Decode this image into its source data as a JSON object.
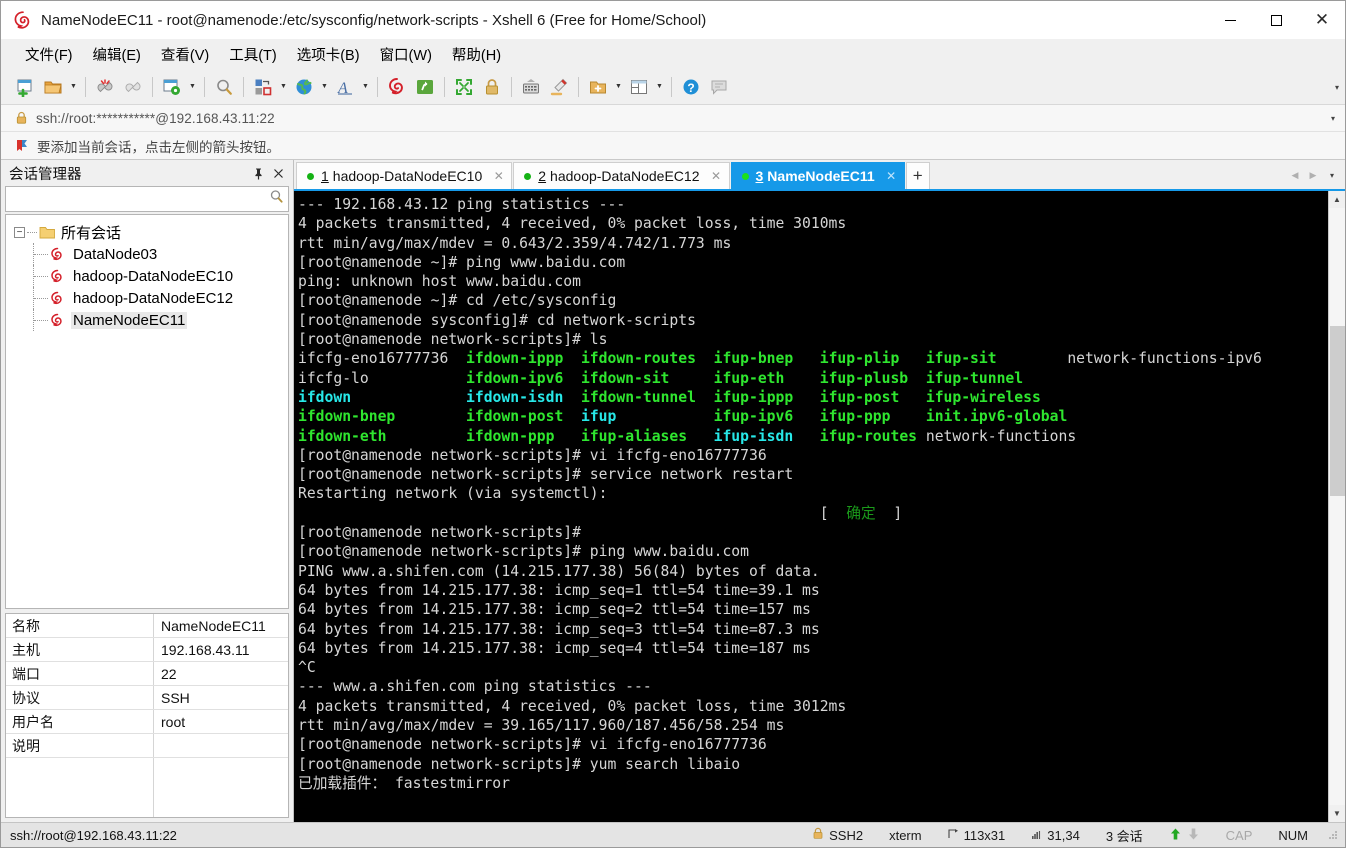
{
  "window": {
    "title": "NameNodeEC11 - root@namenode:/etc/sysconfig/network-scripts - Xshell 6 (Free for Home/School)",
    "app_icon": "xshell-logo-icon",
    "minimize_label": "",
    "maximize_label": "",
    "close_label": "✕"
  },
  "menubar": {
    "items": [
      {
        "label": "文件(F)",
        "name": "menu-file"
      },
      {
        "label": "编辑(E)",
        "name": "menu-edit"
      },
      {
        "label": "查看(V)",
        "name": "menu-view"
      },
      {
        "label": "工具(T)",
        "name": "menu-tools"
      },
      {
        "label": "选项卡(B)",
        "name": "menu-tabs"
      },
      {
        "label": "窗口(W)",
        "name": "menu-window"
      },
      {
        "label": "帮助(H)",
        "name": "menu-help"
      }
    ]
  },
  "toolbar": {
    "icons": [
      "new-session-icon",
      "open-folder-icon",
      "disconnect-icon",
      "reconnect-icon",
      "session-properties-icon",
      "find-icon",
      "transfer-file-icon",
      "globe-icon",
      "font-icon",
      "xshell-icon",
      "xftp-icon",
      "fullscreen-icon",
      "lock-icon",
      "keyboard-icon",
      "highlight-icon",
      "new-folder-icon",
      "layout-icon",
      "help-icon",
      "comment-icon"
    ],
    "overflow_label": "▾"
  },
  "address_bar": {
    "lock_icon": "lock-icon",
    "value": "ssh://root:***********@192.168.43.11:22",
    "chevron": "▾"
  },
  "hint_bar": {
    "icon": "bookmark-flag-icon",
    "text": "要添加当前会话，点击左侧的箭头按钮。"
  },
  "sidebar": {
    "title": "会话管理器",
    "pin_label": "⚐",
    "close_label": "✕",
    "search": {
      "value": "",
      "placeholder": "",
      "icon": "search-icon"
    },
    "tree": {
      "root": {
        "label": "所有会话",
        "expander": "−",
        "icon": "folder-icon"
      },
      "children": [
        {
          "label": "DataNode03",
          "icon": "session-icon",
          "selected": false
        },
        {
          "label": "hadoop-DataNodeEC10",
          "icon": "session-icon",
          "selected": false
        },
        {
          "label": "hadoop-DataNodeEC12",
          "icon": "session-icon",
          "selected": false
        },
        {
          "label": "NameNodeEC11",
          "icon": "session-icon",
          "selected": true
        }
      ]
    },
    "properties": [
      {
        "key": "名称",
        "value": "NameNodeEC11"
      },
      {
        "key": "主机",
        "value": "192.168.43.11"
      },
      {
        "key": "端口",
        "value": "22"
      },
      {
        "key": "协议",
        "value": "SSH"
      },
      {
        "key": "用户名",
        "value": "root"
      },
      {
        "key": "说明",
        "value": ""
      }
    ]
  },
  "tabs": {
    "items": [
      {
        "num": "1",
        "label": "hadoop-DataNodeEC10",
        "active": false,
        "close": "✕"
      },
      {
        "num": "2",
        "label": "hadoop-DataNodeEC12",
        "active": false,
        "close": "✕"
      },
      {
        "num": "3",
        "label": "NameNodeEC11",
        "active": true,
        "close": "✕"
      }
    ],
    "new_tab_label": "+",
    "nav_prev": "◀",
    "nav_next": "▶",
    "nav_menu": "▾"
  },
  "terminal": {
    "lines": [
      [
        {
          "t": "--- 192.168.43.12 ping statistics ---",
          "c": "white"
        }
      ],
      [
        {
          "t": "4 packets transmitted, 4 received, 0% packet loss, time 3010ms",
          "c": "white"
        }
      ],
      [
        {
          "t": "rtt min/avg/max/mdev = 0.643/2.359/4.742/1.773 ms",
          "c": "white"
        }
      ],
      [
        {
          "t": "[root@namenode ~]# ping www.baidu.com",
          "c": "white"
        }
      ],
      [
        {
          "t": "ping: unknown host www.baidu.com",
          "c": "white"
        }
      ],
      [
        {
          "t": "[root@namenode ~]# cd /etc/sysconfig",
          "c": "white"
        }
      ],
      [
        {
          "t": "[root@namenode sysconfig]# cd network-scripts",
          "c": "white"
        }
      ],
      [
        {
          "t": "[root@namenode network-scripts]# ls",
          "c": "white"
        }
      ],
      [
        {
          "t": "ifcfg-eno16777736  ",
          "c": "white"
        },
        {
          "t": "ifdown-ippp  ifdown-routes  ifup-bnep   ifup-plip   ifup-sit        ",
          "c": "green"
        },
        {
          "t": "network-functions-ipv6",
          "c": "white"
        }
      ],
      [
        {
          "t": "ifcfg-lo           ",
          "c": "white"
        },
        {
          "t": "ifdown-ipv6  ifdown-sit     ifup-eth    ifup-plusb  ifup-tunnel",
          "c": "green"
        }
      ],
      [
        {
          "t": "ifdown",
          "c": "cyan"
        },
        {
          "t": "             ",
          "c": "white"
        },
        {
          "t": "ifdown-isdn",
          "c": "cyan"
        },
        {
          "t": "  ifdown-tunnel  ifup-ippp   ifup-post   ifup-wireless",
          "c": "green"
        }
      ],
      [
        {
          "t": "ifdown-bnep",
          "c": "green"
        },
        {
          "t": "        ifdown-post  ",
          "c": "green"
        },
        {
          "t": "ifup",
          "c": "cyan"
        },
        {
          "t": "           ifup-ipv6   ifup-ppp    init.ipv6-global",
          "c": "green"
        }
      ],
      [
        {
          "t": "ifdown-eth",
          "c": "green"
        },
        {
          "t": "         ifdown-ppp   ifup-aliases   ",
          "c": "green"
        },
        {
          "t": "ifup-isdn",
          "c": "cyan"
        },
        {
          "t": "   ifup-routes ",
          "c": "green"
        },
        {
          "t": "network-functions",
          "c": "white"
        }
      ],
      [
        {
          "t": "[root@namenode network-scripts]# vi ifcfg-eno16777736",
          "c": "white"
        }
      ],
      [
        {
          "t": "[root@namenode network-scripts]# service network restart",
          "c": "white"
        }
      ],
      [
        {
          "t": "Restarting network (via systemctl):",
          "c": "white"
        }
      ],
      [
        {
          "t": "                                                           [  ",
          "c": "white"
        },
        {
          "t": "确定",
          "c": "dgreen"
        },
        {
          "t": "  ]",
          "c": "white"
        }
      ],
      [
        {
          "t": "[root@namenode network-scripts]#",
          "c": "white"
        }
      ],
      [
        {
          "t": "[root@namenode network-scripts]# ping www.baidu.com",
          "c": "white"
        }
      ],
      [
        {
          "t": "PING www.a.shifen.com (14.215.177.38) 56(84) bytes of data.",
          "c": "white"
        }
      ],
      [
        {
          "t": "64 bytes from 14.215.177.38: icmp_seq=1 ttl=54 time=39.1 ms",
          "c": "white"
        }
      ],
      [
        {
          "t": "64 bytes from 14.215.177.38: icmp_seq=2 ttl=54 time=157 ms",
          "c": "white"
        }
      ],
      [
        {
          "t": "64 bytes from 14.215.177.38: icmp_seq=3 ttl=54 time=87.3 ms",
          "c": "white"
        }
      ],
      [
        {
          "t": "64 bytes from 14.215.177.38: icmp_seq=4 ttl=54 time=187 ms",
          "c": "white"
        }
      ],
      [
        {
          "t": "^C",
          "c": "white"
        }
      ],
      [
        {
          "t": "--- www.a.shifen.com ping statistics ---",
          "c": "white"
        }
      ],
      [
        {
          "t": "4 packets transmitted, 4 received, 0% packet loss, time 3012ms",
          "c": "white"
        }
      ],
      [
        {
          "t": "rtt min/avg/max/mdev = 39.165/117.960/187.456/58.254 ms",
          "c": "white"
        }
      ],
      [
        {
          "t": "[root@namenode network-scripts]# vi ifcfg-eno16777736",
          "c": "white"
        }
      ],
      [
        {
          "t": "[root@namenode network-scripts]# yum search libaio",
          "c": "white"
        }
      ],
      [
        {
          "t": "已加载插件： fastestmirror",
          "c": "white"
        }
      ]
    ],
    "scroll_up": "▲",
    "scroll_down": "▼"
  },
  "statusbar": {
    "connection": "ssh://root@192.168.43.11:22",
    "security": "SSH2",
    "security_icon": "lock-icon",
    "terminal_type": "xterm",
    "size_icon": "resize-icon",
    "size": "113x31",
    "cursor_icon": "cursor-icon",
    "cursor": "31,34",
    "sessions": "3 会话",
    "up_arrow": "⬆",
    "down_arrow": "⬇",
    "cap": "CAP",
    "num": "NUM"
  },
  "colors": {
    "accent": "#1699e8",
    "terminal_bg": "#000000",
    "terminal_fg": "#d6d6d6",
    "green": "#2fe62f",
    "cyan": "#27e8e8",
    "chrome": "#f0f0f0"
  }
}
